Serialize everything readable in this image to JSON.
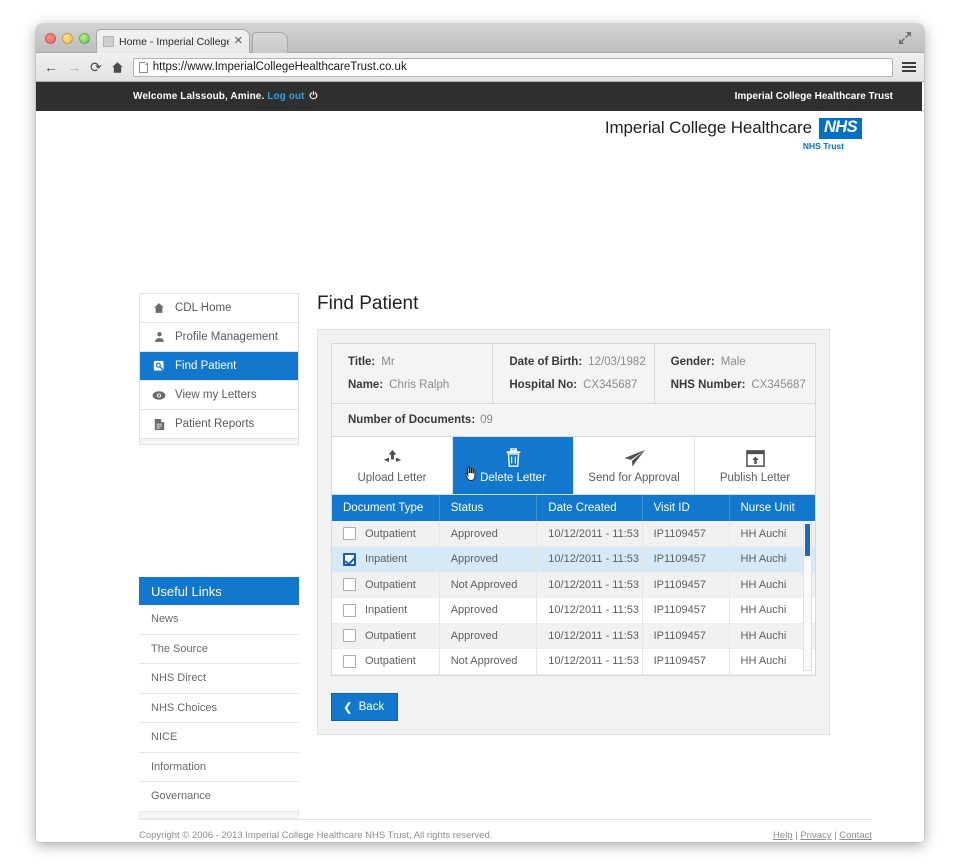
{
  "browser": {
    "tab_title": "Home - Imperial College...",
    "url": "https://www.ImperialCollegeHealthcareTrust.co.uk",
    "back_icon": "back-arrow-icon",
    "forward_icon": "forward-arrow-icon",
    "reload_icon": "reload-icon",
    "home_icon": "home-icon",
    "menu_icon": "hamburger-menu-icon",
    "expand_icon": "fullscreen-icon",
    "close_tab_icon": "close-icon"
  },
  "topbar": {
    "welcome_prefix": "Welcome Lalssoub, Amine.",
    "logout_label": "Log out",
    "power_icon": "power-icon",
    "org_name": "Imperial College Healthcare Trust"
  },
  "logo": {
    "words": "Imperial College Healthcare",
    "nhs": "NHS",
    "trust": "NHS Trust",
    "brand_color": "#0072c6"
  },
  "sidebar": {
    "items": [
      {
        "label": "CDL Home",
        "icon": "home-icon",
        "active": false
      },
      {
        "label": "Profile Management",
        "icon": "user-icon",
        "active": false
      },
      {
        "label": "Find Patient",
        "icon": "patient-search-icon",
        "active": true
      },
      {
        "label": "View my Letters",
        "icon": "eye-icon",
        "active": false
      },
      {
        "label": "Patient Reports",
        "icon": "document-icon",
        "active": false
      }
    ]
  },
  "useful_links": {
    "heading": "Useful Links",
    "items": [
      "News",
      "The Source",
      "NHS Direct",
      "NHS Choices",
      "NICE",
      "Information",
      "Governance"
    ]
  },
  "main": {
    "page_title": "Find Patient",
    "patient": {
      "title_label": "Title:",
      "title_value": "Mr",
      "name_label": "Name:",
      "name_value": "Chris Ralph",
      "dob_label": "Date of Birth:",
      "dob_value": "12/03/1982",
      "hospital_label": "Hospital No:",
      "hospital_value": "CX345687",
      "gender_label": "Gender:",
      "gender_value": "Male",
      "nhs_label": "NHS Number:",
      "nhs_value": "CX345687",
      "docs_label": "Number of Documents:",
      "docs_value": "09"
    },
    "toolbar": [
      {
        "label": "Upload Letter",
        "icon": "upload-icon",
        "active": false
      },
      {
        "label": "Delete Letter",
        "icon": "trash-icon",
        "active": true
      },
      {
        "label": "Send for Approval",
        "icon": "paper-plane-icon",
        "active": false
      },
      {
        "label": "Publish Letter",
        "icon": "publish-window-icon",
        "active": false
      }
    ],
    "table": {
      "columns": [
        "Document Type",
        "Status",
        "Date Created",
        "Visit ID",
        "Nurse Unit"
      ],
      "rows": [
        {
          "checked": false,
          "document_type": "Outpatient",
          "status": "Approved",
          "date_created": "10/12/2011 - 11:53",
          "visit_id": "IP1109457",
          "nurse_unit": "HH Auchi",
          "selected": false
        },
        {
          "checked": true,
          "document_type": "Inpatient",
          "status": "Approved",
          "date_created": "10/12/2011 - 11:53",
          "visit_id": "IP1109457",
          "nurse_unit": "HH Auchi",
          "selected": true
        },
        {
          "checked": false,
          "document_type": "Outpatient",
          "status": "Not Approved",
          "date_created": "10/12/2011 - 11:53",
          "visit_id": "IP1109457",
          "nurse_unit": "HH Auchi",
          "selected": false
        },
        {
          "checked": false,
          "document_type": "Inpatient",
          "status": "Approved",
          "date_created": "10/12/2011 - 11:53",
          "visit_id": "IP1109457",
          "nurse_unit": "HH Auchi",
          "selected": false
        },
        {
          "checked": false,
          "document_type": "Outpatient",
          "status": "Approved",
          "date_created": "10/12/2011 - 11:53",
          "visit_id": "IP1109457",
          "nurse_unit": "HH Auchi",
          "selected": false
        },
        {
          "checked": false,
          "document_type": "Outpatient",
          "status": "Not Approved",
          "date_created": "10/12/2011 - 11:53",
          "visit_id": "IP1109457",
          "nurse_unit": "HH Auchi",
          "selected": false
        }
      ],
      "row_action_icon": "magnifier-zoom-icon"
    },
    "back_label": "Back",
    "back_icon": "chevron-left-icon"
  },
  "footer": {
    "copyright": "Copyright © 2006 - 2013 Imperial College Healthcare NHS Trust, All rights reserved.",
    "links": [
      "Help",
      "Privacy",
      "Contact"
    ],
    "separator": "|"
  },
  "colors": {
    "accent": "#1278ce",
    "topbar": "#2f2f2f",
    "selected_row": "#d5e9f7"
  }
}
